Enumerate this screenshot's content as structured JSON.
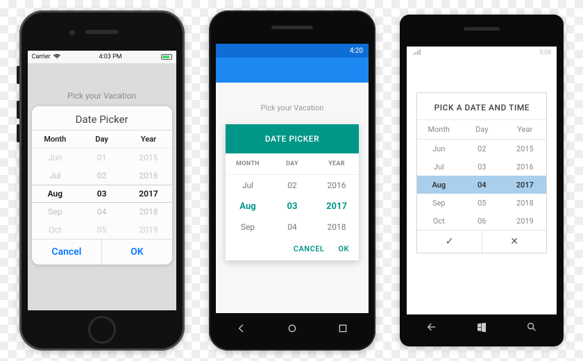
{
  "ios": {
    "statusbar": {
      "carrier": "Carrier",
      "wifi": "wifi-icon",
      "time": "4:03 PM"
    },
    "prompt": "Pick your Vacation",
    "sheet_title": "Date Picker",
    "columns": {
      "month": "Month",
      "day": "Day",
      "year": "Year"
    },
    "rows_above": [
      {
        "month": "Jun",
        "day": "01",
        "year": "2015"
      },
      {
        "month": "Jul",
        "day": "02",
        "year": "2016"
      }
    ],
    "selected": {
      "month": "Aug",
      "day": "03",
      "year": "2017"
    },
    "rows_below": [
      {
        "month": "Sep",
        "day": "04",
        "year": "2018"
      },
      {
        "month": "Oct",
        "day": "05",
        "year": "2019"
      }
    ],
    "cancel": "Cancel",
    "ok": "OK"
  },
  "android": {
    "statusbar": {
      "time": "4:20"
    },
    "prompt": "Pick your Vacation",
    "header": "DATE PICKER",
    "columns": {
      "month": "MONTH",
      "day": "DAY",
      "year": "YEAR"
    },
    "rows_above": [
      {
        "month": "Jul",
        "day": "02",
        "year": "2016"
      }
    ],
    "selected": {
      "month": "Aug",
      "day": "03",
      "year": "2017"
    },
    "rows_below": [
      {
        "month": "Sep",
        "day": "04",
        "year": "2018"
      }
    ],
    "cancel": "CANCEL",
    "ok": "OK",
    "accent": "#009688"
  },
  "wp": {
    "statusbar": {
      "signal": "signal-icon",
      "time": "5:06"
    },
    "title": "PICK A DATE AND TIME",
    "columns": {
      "month": "Month",
      "day": "Day",
      "year": "Year"
    },
    "rows": [
      {
        "month": "Jun",
        "day": "02",
        "year": "2015"
      },
      {
        "month": "Jul",
        "day": "03",
        "year": "2016"
      },
      {
        "month": "Aug",
        "day": "04",
        "year": "2017"
      },
      {
        "month": "Sep",
        "day": "05",
        "year": "2018"
      },
      {
        "month": "Oct",
        "day": "06",
        "year": "2019"
      }
    ],
    "selected_index": 2,
    "ok_glyph": "✓",
    "cancel_glyph": "✕"
  }
}
